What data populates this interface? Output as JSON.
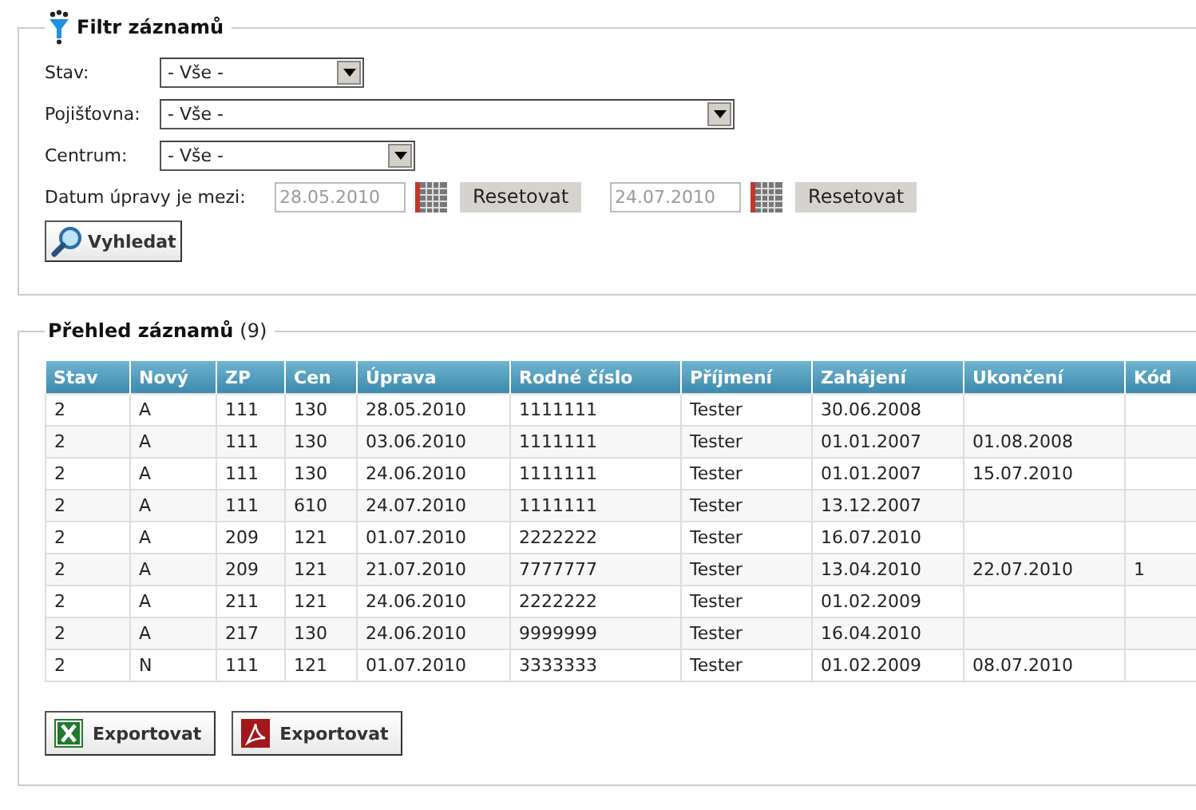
{
  "filter": {
    "title": "Filtr záznamů",
    "fields": [
      {
        "label": "Stav:",
        "value": "- Vše -",
        "kind": "short"
      },
      {
        "label": "Pojišťovna:",
        "value": "- Vše -",
        "kind": "long"
      },
      {
        "label": "Centrum:",
        "value": "- Vše -",
        "kind": "medium"
      }
    ],
    "date_label": "Datum úpravy je mezi:",
    "dates": [
      {
        "value": "28.05.2010",
        "reset": "Resetovat"
      },
      {
        "value": "24.07.2010",
        "reset": "Resetovat"
      }
    ],
    "search_button": "Vyhledat"
  },
  "records": {
    "title": "Přehled záznamů",
    "count": "(9)",
    "table": {
      "columns": [
        "Stav",
        "Nový",
        "ZP",
        "Cen",
        "Úprava",
        "Rodné číslo",
        "Příjmení",
        "Zahájení",
        "Ukončení",
        "Kód"
      ],
      "rows": [
        [
          "2",
          "A",
          "111",
          "130",
          "28.05.2010",
          "1111111",
          "Tester",
          "30.06.2008",
          "",
          ""
        ],
        [
          "2",
          "A",
          "111",
          "130",
          "03.06.2010",
          "1111111",
          "Tester",
          "01.01.2007",
          "01.08.2008",
          ""
        ],
        [
          "2",
          "A",
          "111",
          "130",
          "24.06.2010",
          "1111111",
          "Tester",
          "01.01.2007",
          "15.07.2010",
          ""
        ],
        [
          "2",
          "A",
          "111",
          "610",
          "24.07.2010",
          "1111111",
          "Tester",
          "13.12.2007",
          "",
          ""
        ],
        [
          "2",
          "A",
          "209",
          "121",
          "01.07.2010",
          "2222222",
          "Tester",
          "16.07.2010",
          "",
          ""
        ],
        [
          "2",
          "A",
          "209",
          "121",
          "21.07.2010",
          "7777777",
          "Tester",
          "13.04.2010",
          "22.07.2010",
          "1"
        ],
        [
          "2",
          "A",
          "211",
          "121",
          "24.06.2010",
          "2222222",
          "Tester",
          "01.02.2009",
          "",
          ""
        ],
        [
          "2",
          "A",
          "217",
          "130",
          "24.06.2010",
          "9999999",
          "Tester",
          "16.04.2010",
          "",
          ""
        ],
        [
          "2",
          "N",
          "111",
          "121",
          "01.07.2010",
          "3333333",
          "Tester",
          "01.02.2009",
          "08.07.2010",
          ""
        ]
      ]
    },
    "export_buttons": [
      {
        "kind": "excel",
        "label": "Exportovat"
      },
      {
        "kind": "pdf",
        "label": "Exportovat"
      }
    ]
  }
}
